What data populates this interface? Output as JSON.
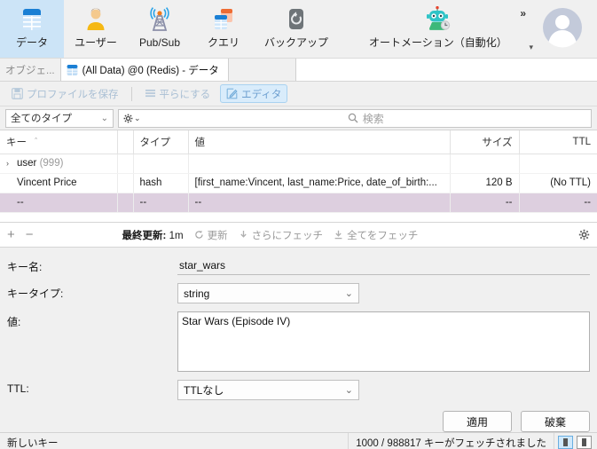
{
  "ribbon": {
    "items": [
      {
        "label": "データ",
        "icon": "data-table-icon",
        "active": true
      },
      {
        "label": "ユーザー",
        "icon": "user-icon",
        "active": false
      },
      {
        "label": "Pub/Sub",
        "icon": "broadcast-tower-icon",
        "active": false
      },
      {
        "label": "クエリ",
        "icon": "query-icon",
        "active": false
      },
      {
        "label": "バックアップ",
        "icon": "backup-restore-icon",
        "active": false
      },
      {
        "label": "オートメーション（自動化）",
        "icon": "robot-automation-icon",
        "active": false
      }
    ],
    "overflow_label": "»",
    "caret_label": "▾",
    "avatar_icon": "avatar-icon"
  },
  "tabbar": {
    "object_tab": "オブジェ...",
    "active_tab": "(All Data) @0 (Redis) - データ",
    "active_tab_icon": "data-table-icon"
  },
  "editor_toolbar": {
    "save_profile": "プロファイルを保存",
    "save_profile_icon": "save-disk-icon",
    "flatten": "平らにする",
    "flatten_icon": "flatten-rows-icon",
    "editor": "エディタ",
    "editor_icon": "pencil-edit-icon"
  },
  "filterbar": {
    "type_filter": "全てのタイプ",
    "type_filter_caret": "⌄",
    "gear_icon": "gear-icon",
    "gear_caret": "⌄",
    "search_icon": "search-icon",
    "search_placeholder": "検索",
    "search_value": ""
  },
  "table": {
    "columns": [
      {
        "label": "キー",
        "sort": "＾"
      },
      {
        "label": ""
      },
      {
        "label": "タイプ"
      },
      {
        "label": "値"
      },
      {
        "label": "サイズ"
      },
      {
        "label": "TTL"
      }
    ],
    "rows": [
      {
        "expander": "›",
        "key": "user",
        "count": "(999)",
        "type": "",
        "value": "",
        "size": "",
        "ttl": "",
        "selected": false
      },
      {
        "expander": "",
        "key": "Vincent Price",
        "count": "",
        "type": "hash",
        "value": "[first_name:Vincent, last_name:Price, date_of_birth:...",
        "size": "120 B",
        "ttl": "(No TTL)",
        "selected": false
      },
      {
        "expander": "",
        "key": "--",
        "count": "",
        "type": "--",
        "value": "--",
        "size": "--",
        "ttl": "--",
        "selected": true
      }
    ]
  },
  "subbar": {
    "add_icon": "plus-icon",
    "remove_icon": "minus-icon",
    "last_update_label": "最終更新:",
    "last_update_value": "1m",
    "refresh_icon": "refresh-icon",
    "refresh_label": "更新",
    "fetch_more_icon": "download-arrow-icon",
    "fetch_more_label": "さらにフェッチ",
    "fetch_all_icon": "download-all-icon",
    "fetch_all_label": "全てをフェッチ",
    "settings_icon": "gear-icon"
  },
  "form": {
    "key_name_label": "キー名:",
    "key_name_value": "star_wars",
    "key_type_label": "キータイプ:",
    "key_type_value": "string",
    "key_type_caret": "⌄",
    "value_label": "値:",
    "value_value": "Star Wars (Episode IV)",
    "ttl_label": "TTL:",
    "ttl_value": "TTLなし",
    "ttl_caret": "⌄",
    "apply_button": "適用",
    "discard_button": "破棄"
  },
  "statusbar": {
    "left_text": "新しいキー",
    "right_text": "1000 / 988817 キーがフェッチされました",
    "pane_toggle_1_icon": "pane-left-split-icon",
    "pane_toggle_2_icon": "pane-right-split-icon"
  },
  "colors": {
    "ribbon_active": "#cce4f7",
    "row_selected": "#ddcfdf",
    "editor_active": "#d9ecfb"
  }
}
